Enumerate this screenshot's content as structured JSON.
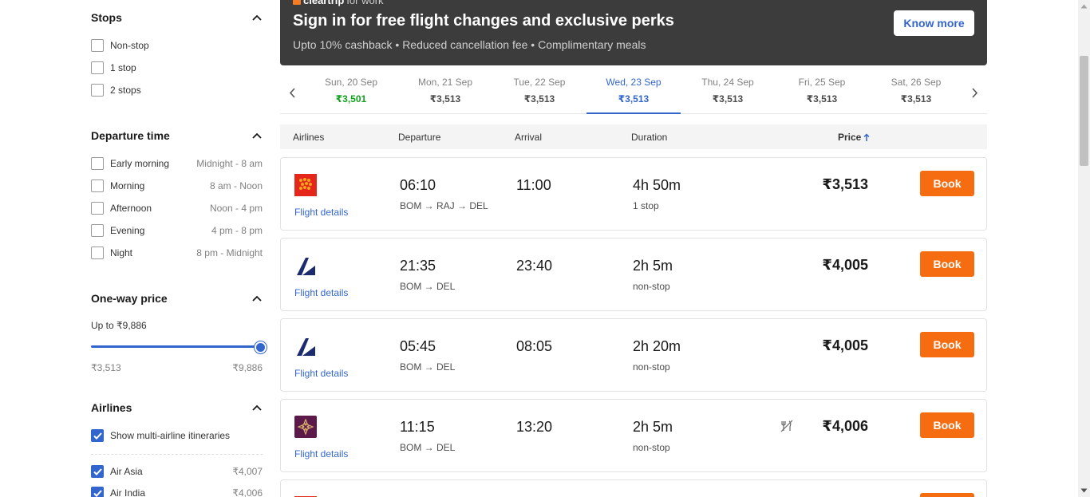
{
  "filters": {
    "stops": {
      "title": "Stops",
      "options": [
        {
          "label": "Non-stop",
          "checked": false
        },
        {
          "label": "1 stop",
          "checked": false
        },
        {
          "label": "2 stops",
          "checked": false
        }
      ]
    },
    "departure_time": {
      "title": "Departure time",
      "options": [
        {
          "label": "Early morning",
          "range": "Midnight - 8 am",
          "checked": false
        },
        {
          "label": "Morning",
          "range": "8 am - Noon",
          "checked": false
        },
        {
          "label": "Afternoon",
          "range": "Noon - 4 pm",
          "checked": false
        },
        {
          "label": "Evening",
          "range": "4 pm - 8 pm",
          "checked": false
        },
        {
          "label": "Night",
          "range": "8 pm - Midnight",
          "checked": false
        }
      ]
    },
    "one_way_price": {
      "title": "One-way price",
      "subtitle": "Up to ₹9,886",
      "min_label": "₹3,513",
      "max_label": "₹9,886",
      "slider_value_fraction": 1.0
    },
    "airlines": {
      "title": "Airlines",
      "multi_airline": {
        "label": "Show multi-airline itineraries",
        "checked": true
      },
      "options": [
        {
          "label": "Air Asia",
          "price": "₹4,007",
          "checked": true
        },
        {
          "label": "Air India",
          "price": "₹4,006",
          "checked": true
        }
      ]
    }
  },
  "banner": {
    "brand": "cleartrip",
    "brand_suffix": "for work",
    "title": "Sign in for free flight changes and exclusive perks",
    "subtitle": "Upto 10% cashback • Reduced cancellation fee • Complimentary meals",
    "cta": "Know more"
  },
  "dates": [
    {
      "day": "Sun, 20 Sep",
      "price": "₹3,501",
      "state": "cheap"
    },
    {
      "day": "Mon, 21 Sep",
      "price": "₹3,513",
      "state": ""
    },
    {
      "day": "Tue, 22 Sep",
      "price": "₹3,513",
      "state": ""
    },
    {
      "day": "Wed, 23 Sep",
      "price": "₹3,513",
      "state": "active"
    },
    {
      "day": "Thu, 24 Sep",
      "price": "₹3,513",
      "state": ""
    },
    {
      "day": "Fri, 25 Sep",
      "price": "₹3,513",
      "state": ""
    },
    {
      "day": "Sat, 26 Sep",
      "price": "₹3,513",
      "state": ""
    }
  ],
  "table_header": {
    "airlines": "Airlines",
    "departure": "Departure",
    "arrival": "Arrival",
    "duration": "Duration",
    "price": "Price"
  },
  "flights": [
    {
      "logo": "spicejet-logo",
      "details": "Flight details",
      "dep": "06:10",
      "route": "BOM → RAJ → DEL",
      "arr": "11:00",
      "duration": "4h 50m",
      "stops": "1 stop",
      "price": "₹3,513",
      "book": "Book",
      "no_meal": false
    },
    {
      "logo": "goair-logo",
      "details": "Flight details",
      "dep": "21:35",
      "route": "BOM → DEL",
      "arr": "23:40",
      "duration": "2h 5m",
      "stops": "non-stop",
      "price": "₹4,005",
      "book": "Book",
      "no_meal": false
    },
    {
      "logo": "goair-logo",
      "details": "Flight details",
      "dep": "05:45",
      "route": "BOM → DEL",
      "arr": "08:05",
      "duration": "2h 20m",
      "stops": "non-stop",
      "price": "₹4,005",
      "book": "Book",
      "no_meal": false
    },
    {
      "logo": "vistara-logo",
      "details": "Flight details",
      "dep": "11:15",
      "route": "BOM → DEL",
      "arr": "13:20",
      "duration": "2h 5m",
      "stops": "non-stop",
      "price": "₹4,006",
      "book": "Book",
      "no_meal": true
    },
    {
      "logo": "spicejet-logo",
      "details": "",
      "dep": "",
      "route": "",
      "arr": "",
      "duration": "",
      "stops": "",
      "price": "",
      "book": "",
      "no_meal": false
    }
  ],
  "colors": {
    "accent": "#3366cc",
    "book": "#f56d10",
    "cheap": "#11a11e",
    "banner_bg": "#3c3c3c"
  }
}
